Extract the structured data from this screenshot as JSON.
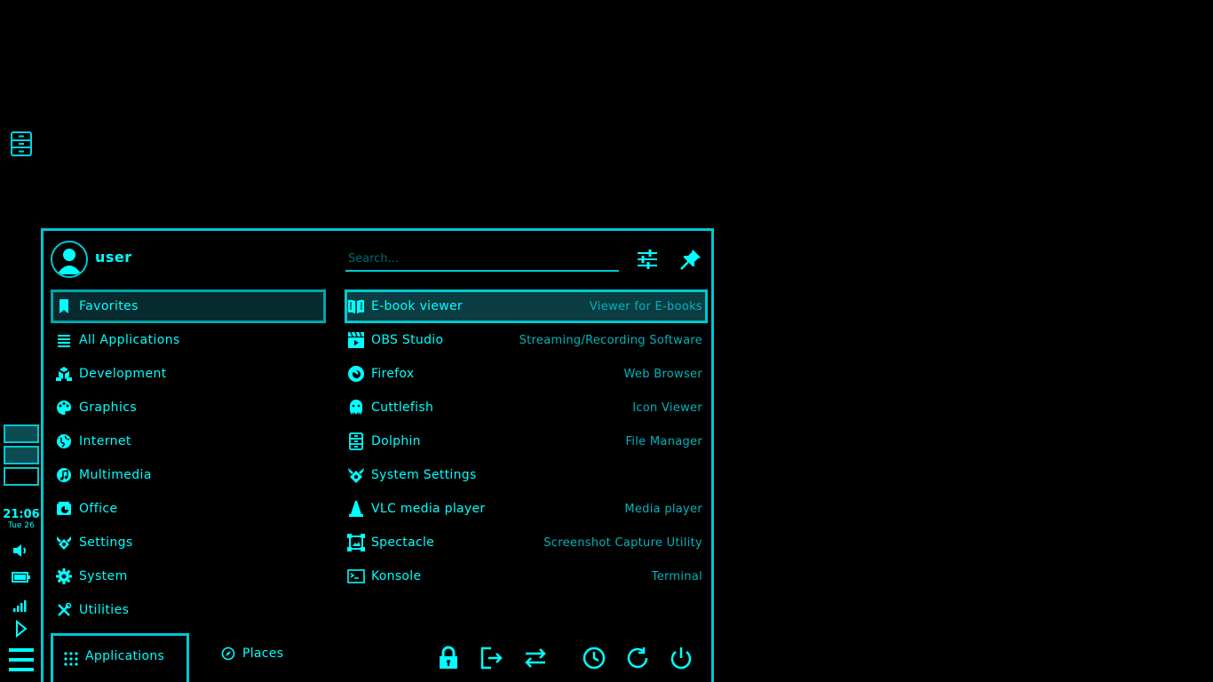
{
  "desktop": {
    "icon": "file-cabinet-icon"
  },
  "panel": {
    "clock_time": "21:06",
    "clock_date": "Tue 26",
    "virtual_desktops": 3,
    "tray_icons": [
      "volume-icon",
      "battery-icon",
      "network-icon",
      "expand-tray-icon"
    ],
    "menu_icon": "hamburger-menu-icon"
  },
  "launcher": {
    "user": {
      "name": "user"
    },
    "search": {
      "placeholder": "Search..."
    },
    "categories": [
      {
        "label": "Favorites",
        "icon": "bookmark-icon",
        "selected": true
      },
      {
        "label": "All Applications",
        "icon": "list-icon"
      },
      {
        "label": "Development",
        "icon": "code-cubes-icon"
      },
      {
        "label": "Graphics",
        "icon": "palette-icon"
      },
      {
        "label": "Internet",
        "icon": "globe-icon"
      },
      {
        "label": "Multimedia",
        "icon": "music-icon"
      },
      {
        "label": "Office",
        "icon": "office-icon"
      },
      {
        "label": "Settings",
        "icon": "settings-icon"
      },
      {
        "label": "System",
        "icon": "gear-icon"
      },
      {
        "label": "Utilities",
        "icon": "tools-icon"
      }
    ],
    "apps": [
      {
        "name": "E-book viewer",
        "desc": "Viewer for E-books",
        "icon": "book-icon",
        "selected": true
      },
      {
        "name": "OBS Studio",
        "desc": "Streaming/Recording Software",
        "icon": "clapperboard-icon"
      },
      {
        "name": "Firefox",
        "desc": "Web Browser",
        "icon": "firefox-icon"
      },
      {
        "name": "Cuttlefish",
        "desc": "Icon Viewer",
        "icon": "cuttlefish-icon"
      },
      {
        "name": "Dolphin",
        "desc": "File Manager",
        "icon": "file-cabinet-icon"
      },
      {
        "name": "System Settings",
        "desc": "",
        "icon": "settings-icon"
      },
      {
        "name": "VLC media player",
        "desc": "Media player",
        "icon": "traffic-cone-icon"
      },
      {
        "name": "Spectacle",
        "desc": "Screenshot Capture Utility",
        "icon": "screenshot-icon"
      },
      {
        "name": "Konsole",
        "desc": "Terminal",
        "icon": "terminal-icon"
      }
    ],
    "tabs": [
      {
        "label": "Applications",
        "icon": "grid-icon",
        "active": true
      },
      {
        "label": "Places",
        "icon": "compass-icon"
      }
    ],
    "power_buttons": [
      "lock-icon",
      "logout-icon",
      "switch-user-icon",
      "sleep-icon",
      "restart-icon",
      "shutdown-icon"
    ]
  }
}
